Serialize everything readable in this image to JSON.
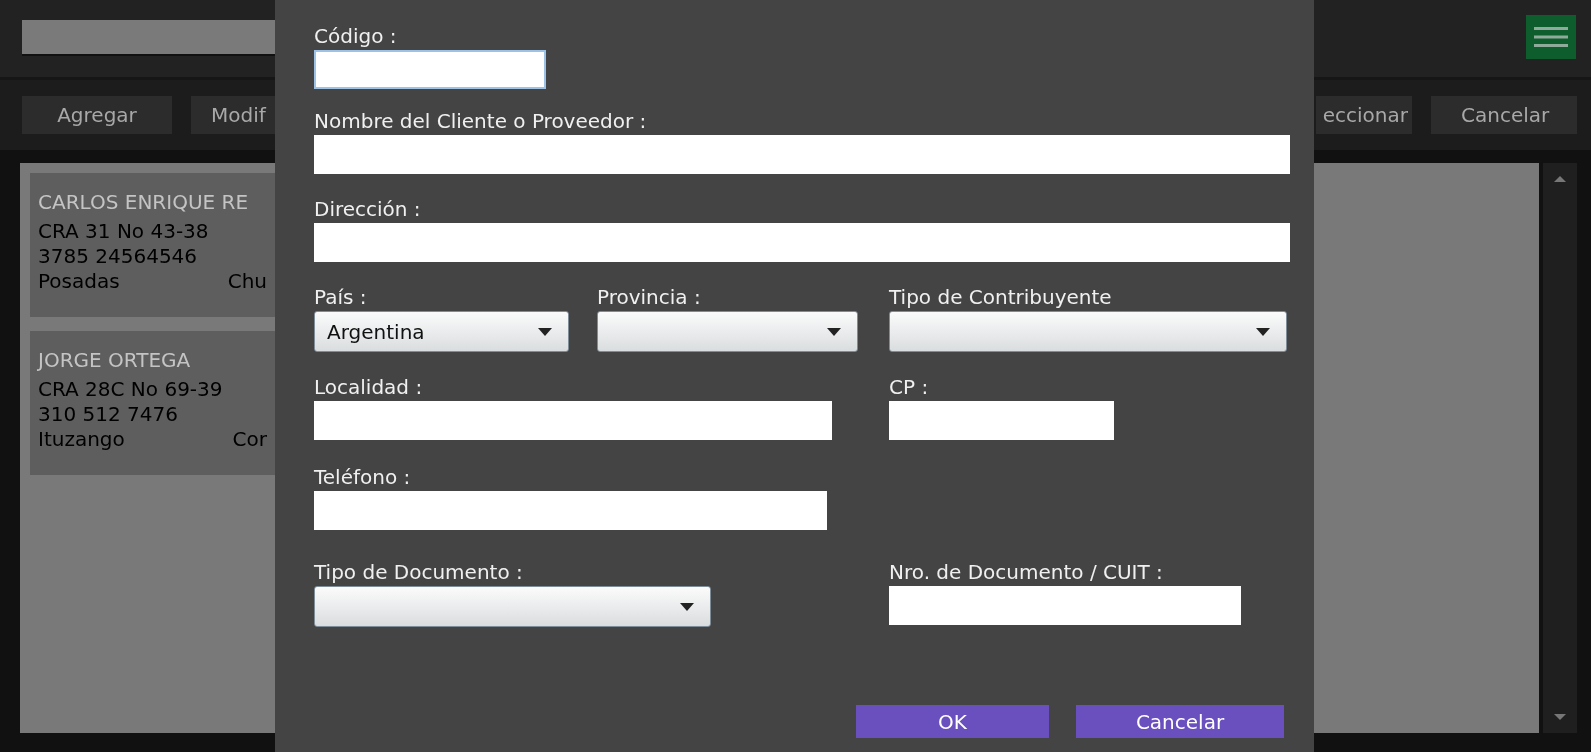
{
  "toolbar": {
    "buttons": [
      "Agregar",
      "Modif",
      "eccionar",
      "Cancelar"
    ]
  },
  "clients": [
    {
      "name": "CARLOS ENRIQUE RE",
      "address": "CRA 31 No 43-38",
      "phone": "3785 24564546",
      "city": "Posadas",
      "column_2": "Chu"
    },
    {
      "name": "JORGE ORTEGA",
      "address": "CRA 28C No 69-39",
      "phone": "310 512 7476",
      "city": "Ituzango",
      "column_2": "Cor"
    }
  ],
  "dialog": {
    "rows": [
      [
        {
          "label": "Código :",
          "kind": "text",
          "focused": true
        }
      ],
      [
        {
          "label": "Nombre del Cliente o Proveedor :",
          "kind": "text",
          "focused": false
        }
      ],
      [
        {
          "label": "Dirección :",
          "kind": "text",
          "focused": false
        }
      ],
      [
        {
          "label": "País :",
          "kind": "select",
          "value": "Argentina"
        },
        {
          "label": "Provincia :",
          "kind": "select"
        },
        {
          "label": "Tipo de Contribuyente",
          "kind": "select"
        }
      ],
      [
        {
          "label": "Localidad :",
          "kind": "text",
          "focused": false
        },
        {
          "label": "CP :",
          "kind": "text",
          "focused": false
        }
      ],
      [
        {
          "label": "Teléfono :",
          "kind": "text",
          "focused": false
        }
      ],
      [
        {
          "label": "Tipo de Documento :",
          "kind": "select"
        },
        {
          "label": "Nro. de Documento / CUIT :",
          "kind": "text",
          "focused": false
        }
      ]
    ],
    "buttons": [
      "OK",
      "Cancelar"
    ]
  }
}
